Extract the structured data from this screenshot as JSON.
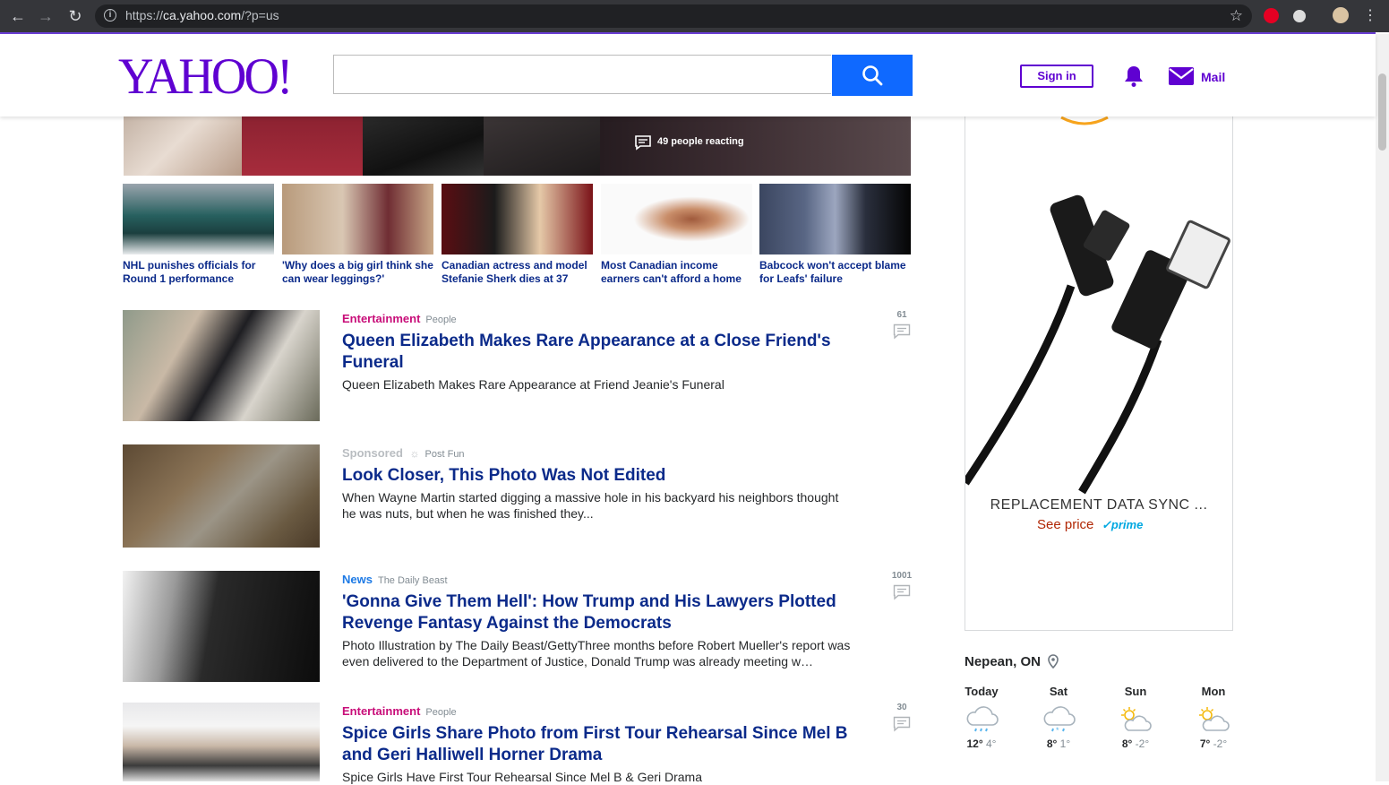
{
  "browser": {
    "url_prefix": "https://",
    "url_host": "ca.yahoo.com",
    "url_path": "/?p=us"
  },
  "header": {
    "logo_text": "YAHOO!",
    "search_placeholder": "",
    "signin_label": "Sign in",
    "mail_label": "Mail",
    "brand_color": "#5f01d1",
    "search_button_color": "#0f69ff"
  },
  "hero": {
    "reactions": "49 people reacting"
  },
  "thumbnails": [
    {
      "caption": "NHL punishes officials for Round 1 performance"
    },
    {
      "caption": "'Why does a big girl think she can wear leggings?'"
    },
    {
      "caption": "Canadian actress and model Stefanie Sherk dies at 37"
    },
    {
      "caption": "Most Canadian income earners can't afford a home"
    },
    {
      "caption": "Babcock won't accept blame for Leafs' failure"
    }
  ],
  "stream": [
    {
      "category": "Entertainment",
      "source": "People",
      "title": "Queen Elizabeth Makes Rare Appearance at a Close Friend's Funeral",
      "summary": "Queen Elizabeth Makes Rare Appearance at Friend Jeanie's Funeral",
      "comments": "61"
    },
    {
      "category": "Sponsored",
      "source": "Post Fun",
      "title": "Look Closer, This Photo Was Not Edited",
      "summary": "When Wayne Martin started digging a massive hole in his backyard his neighbors thought he was nuts, but when he was finished they...",
      "comments": ""
    },
    {
      "category": "News",
      "source": "The Daily Beast",
      "title": "'Gonna Give Them Hell': How Trump and His Lawyers Plotted Revenge Fantasy Against the Democrats",
      "summary": "Photo Illustration by The Daily Beast/GettyThree months before Robert Mueller's report was even delivered to the Department of Justice, Donald Trump was already meeting w…",
      "comments": "1001"
    },
    {
      "category": "Entertainment",
      "source": "People",
      "title": "Spice Girls Share Photo from First Tour Rehearsal Since Mel B and Geri Halliwell Horner Drama",
      "summary": "Spice Girls Have First Tour Rehearsal Since Mel B & Geri Drama",
      "comments": "30"
    }
  ],
  "ad": {
    "title": "REPLACEMENT DATA SYNC ...",
    "price_label": "See price",
    "prime_label": "prime"
  },
  "weather": {
    "location": "Nepean, ON",
    "days": [
      {
        "day": "Today",
        "high": "12°",
        "low": "4°",
        "icon": "rain-cloud-icon"
      },
      {
        "day": "Sat",
        "high": "8°",
        "low": "1°",
        "icon": "snow-rain-cloud-icon"
      },
      {
        "day": "Sun",
        "high": "8°",
        "low": "-2°",
        "icon": "partly-sunny-icon"
      },
      {
        "day": "Mon",
        "high": "7°",
        "low": "-2°",
        "icon": "partly-sunny-icon"
      }
    ]
  }
}
